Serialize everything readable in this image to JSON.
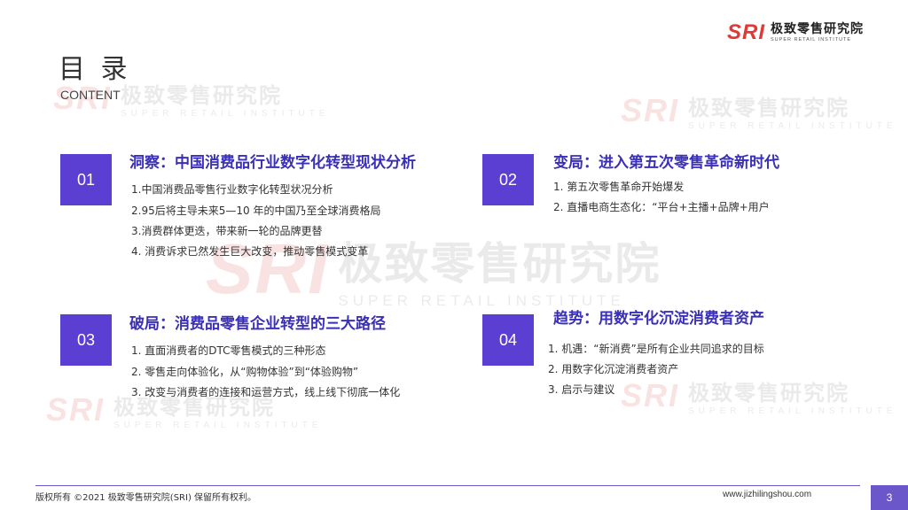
{
  "logo": {
    "mark": "SRI",
    "name_cn": "极致零售研究院",
    "name_en": "SUPER RETAIL INSTITUTE"
  },
  "header": {
    "title": "目 录",
    "subtitle": "CONTENT"
  },
  "sections": [
    {
      "number": "01",
      "title": "洞察：中国消费品行业数字化转型现状分析",
      "items": [
        "1.中国消费品零售行业数字化转型状况分析",
        "2.95后将主导未来5—10 年的中国乃至全球消费格局",
        "3.消费群体更迭，带来新一轮的品牌更替",
        "4. 消费诉求已然发生巨大改变，推动零售模式变革"
      ]
    },
    {
      "number": "02",
      "title": "变局：进入第五次零售革命新时代",
      "items": [
        "1. 第五次零售革命开始爆发",
        "2. 直播电商生态化：“平台+主播+品牌+用户"
      ]
    },
    {
      "number": "03",
      "title": "破局：消费品零售企业转型的三大路径",
      "items": [
        "1. 直面消费者的DTC零售模式的三种形态",
        "2. 零售走向体验化，从“购物体验”到“体验购物”",
        "3. 改变与消费者的连接和运营方式，线上线下彻底一体化"
      ]
    },
    {
      "number": "04",
      "title": "趋势：用数字化沉淀消费者资产",
      "items": [
        "1.  机遇：“新消费”是所有企业共同追求的目标",
        "2.  用数字化沉淀消费者资产",
        "3.  启示与建议"
      ]
    }
  ],
  "footer": {
    "copyright": "版权所有 ©2021  极致零售研究院(SRI)  保留所有权利。",
    "website": "www.jizhilingshou.com",
    "page": "3"
  },
  "colors": {
    "accent": "#5b3fd2",
    "title_purple": "#3a2fb8",
    "logo_red": "#e03a36"
  }
}
